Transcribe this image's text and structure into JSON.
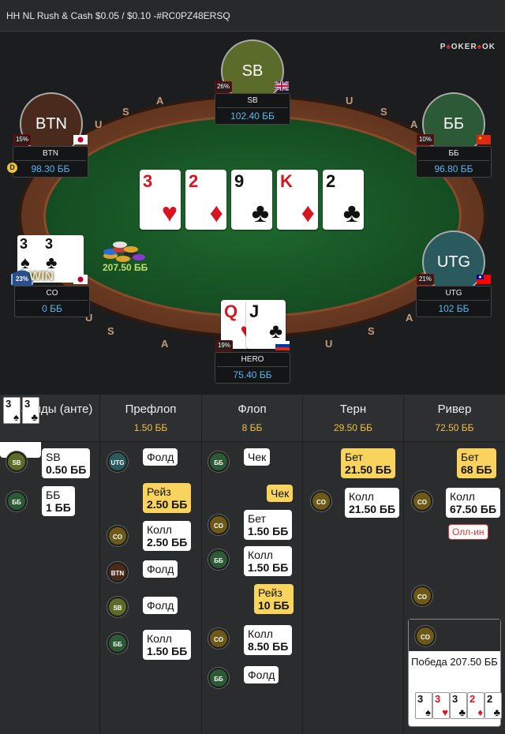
{
  "title": "HH NL Rush & Cash $0.05 / $0.10 -#RC0PZ48ERSQ",
  "logo": {
    "left": "P",
    "mid": "OKER",
    "right": "OK"
  },
  "rail_letters": [
    "U",
    "S",
    "A",
    "U",
    "S",
    "A",
    "U",
    "S",
    "A",
    "U",
    "S",
    "A"
  ],
  "seats": {
    "sb": {
      "avatar": "SB",
      "name": "SB",
      "stack": "102.40 ББ",
      "pct": "26%",
      "color": "#5b6b2a"
    },
    "btn": {
      "avatar": "BTN",
      "name": "BTN",
      "stack": "98.30 ББ",
      "pct": "15%",
      "color": "#4a2a1c"
    },
    "bb": {
      "avatar": "ББ",
      "name": "ББ",
      "stack": "96.80 ББ",
      "pct": "10%",
      "color": "#2c5a36"
    },
    "co": {
      "name": "CO",
      "stack": "0 ББ",
      "pct": "23%"
    },
    "utg": {
      "avatar": "UTG",
      "name": "UTG",
      "stack": "102 ББ",
      "pct": "21%",
      "color": "#2a5a5e"
    },
    "hero": {
      "name": "HERO",
      "stack": "75.40 ББ",
      "pct": "19%"
    }
  },
  "dealer": "D",
  "win_badge": "WIN",
  "board": [
    {
      "rank": "3",
      "suit": "♥",
      "color": "red"
    },
    {
      "rank": "2",
      "suit": "♦",
      "color": "red"
    },
    {
      "rank": "9",
      "suit": "♣",
      "color": "blk"
    },
    {
      "rank": "K",
      "suit": "♦",
      "color": "red"
    },
    {
      "rank": "2",
      "suit": "♣",
      "color": "blk"
    }
  ],
  "co_cards": [
    {
      "rank": "3",
      "suit": "♠"
    },
    {
      "rank": "3",
      "suit": "♣"
    }
  ],
  "hero_cards": [
    {
      "rank": "Q",
      "suit": "♥"
    },
    {
      "rank": "J",
      "suit": "♣"
    }
  ],
  "pot": "207.50 ББ",
  "columns": [
    {
      "title": "Блайнды (анте)",
      "value": ""
    },
    {
      "title": "Префлоп",
      "value": "1.50 ББ"
    },
    {
      "title": "Флоп",
      "value": "8 ББ"
    },
    {
      "title": "Терн",
      "value": "29.50 ББ"
    },
    {
      "title": "Ривер",
      "value": "72.50 ББ"
    }
  ],
  "blinds": [
    {
      "pos": "SB",
      "l1": "SB",
      "l2": "0.50 ББ"
    },
    {
      "pos": "ББ",
      "l1": "ББ",
      "l2": "1 ББ"
    }
  ],
  "preflop": [
    {
      "pos": "UTG",
      "text": "Фолд"
    },
    {
      "text": "Рейз",
      "amt": "2.50 ББ"
    },
    {
      "pos": "CO",
      "text": "Колл",
      "amt": "2.50 ББ"
    },
    {
      "pos": "BTN",
      "text": "Фолд"
    },
    {
      "pos": "SB",
      "text": "Фолд"
    },
    {
      "pos": "ББ",
      "text": "Колл",
      "amt": "1.50 ББ"
    }
  ],
  "flop": [
    {
      "pos": "ББ",
      "text": "Чек"
    },
    {
      "text": "Чек"
    },
    {
      "pos": "CO",
      "text": "Бет",
      "amt": "1.50 ББ"
    },
    {
      "pos": "ББ",
      "text": "Колл",
      "amt": "1.50 ББ"
    },
    {
      "text": "Рейз",
      "amt": "10 ББ"
    },
    {
      "pos": "CO",
      "text": "Колл",
      "amt": "8.50 ББ"
    },
    {
      "pos": "ББ",
      "text": "Фолд"
    }
  ],
  "turn": [
    {
      "text": "Бет",
      "amt": "21.50 ББ"
    },
    {
      "pos": "CO",
      "text": "Колл",
      "amt": "21.50 ББ"
    }
  ],
  "river": [
    {
      "text": "Бет",
      "amt": "68 ББ"
    },
    {
      "pos": "CO",
      "text": "Колл",
      "amt": "67.50 ББ"
    },
    {
      "tag": "Олл-ин"
    },
    {
      "pos": "CO"
    }
  ],
  "win_text": "Победа 207.50 ББ",
  "win_pos": "CO",
  "showdown": {
    "hero": [
      {
        "rank": "Q",
        "suit": "♥"
      },
      {
        "rank": "J",
        "suit": "♣"
      }
    ],
    "co": [
      {
        "rank": "3",
        "suit": "♠"
      },
      {
        "rank": "3",
        "suit": "♣"
      }
    ],
    "win_hand": [
      {
        "rank": "3",
        "suit": "♠"
      },
      {
        "rank": "3",
        "suit": "♥"
      },
      {
        "rank": "3",
        "suit": "♣"
      },
      {
        "rank": "2",
        "suit": "♦"
      },
      {
        "rank": "2",
        "suit": "♣"
      }
    ]
  },
  "chip_colors": {
    "SB": "#5b6b2a",
    "ББ": "#2c5a36",
    "UTG": "#2a5a5e",
    "CO": "#6e5a18",
    "BTN": "#4a2a1c"
  }
}
